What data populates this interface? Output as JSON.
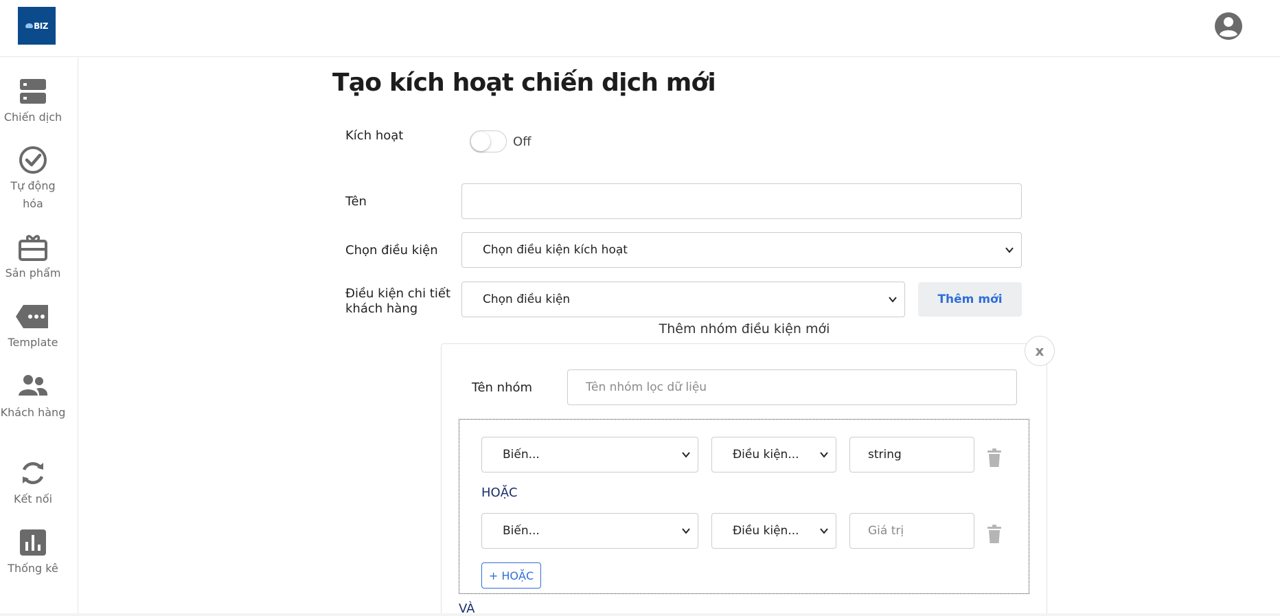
{
  "header": {
    "logo_text": "BIZ",
    "avatar_icon": "user-circle-icon"
  },
  "sidebar": {
    "items": [
      {
        "label": "Chiến dịch",
        "icon": "server-icon"
      },
      {
        "label": "Tự động hóa",
        "icon": "check-circle-icon"
      },
      {
        "label": "Sản phẩm",
        "icon": "gift-icon"
      },
      {
        "label": "Template",
        "icon": "tag-icon"
      },
      {
        "label": "Khách hàng",
        "icon": "users-icon"
      },
      {
        "label": "Kết nối",
        "icon": "refresh-icon"
      },
      {
        "label": "Thống kê",
        "icon": "bar-chart-icon"
      }
    ]
  },
  "page": {
    "title": "Tạo kích hoạt chiến dịch mới"
  },
  "form": {
    "activate_label": "Kích hoạt",
    "activate_state": "Off",
    "name_label": "Tên",
    "name_value": "",
    "condition_label": "Chọn điều kiện",
    "condition_select": "Chọn điều kiện kích hoạt",
    "detail_label_line1": "Điều kiện chi tiết",
    "detail_label_line2": "khách hàng",
    "detail_select": "Chọn điều kiện",
    "add_new_button": "Thêm mới"
  },
  "group": {
    "heading": "Thêm nhóm điều kiện mới",
    "close_label": "x",
    "name_label": "Tên nhóm",
    "name_placeholder": "Tên nhóm lọc dữ liệu",
    "rows": [
      {
        "variable": "Biến...",
        "condition": "Điều kiện...",
        "value": "string",
        "value_is_placeholder": false
      },
      {
        "variable": "Biến...",
        "condition": "Điều kiện...",
        "value": "Giá trị",
        "value_is_placeholder": true
      }
    ],
    "or_label": "HOẶC",
    "add_or_button": "+ HOẶC",
    "and_label": "VÀ"
  },
  "colors": {
    "accent": "#2f6fd6",
    "logo_bg": "#0b4a8b",
    "dark_label": "#1b2e6b",
    "icon_grey": "#6a6a6a"
  }
}
